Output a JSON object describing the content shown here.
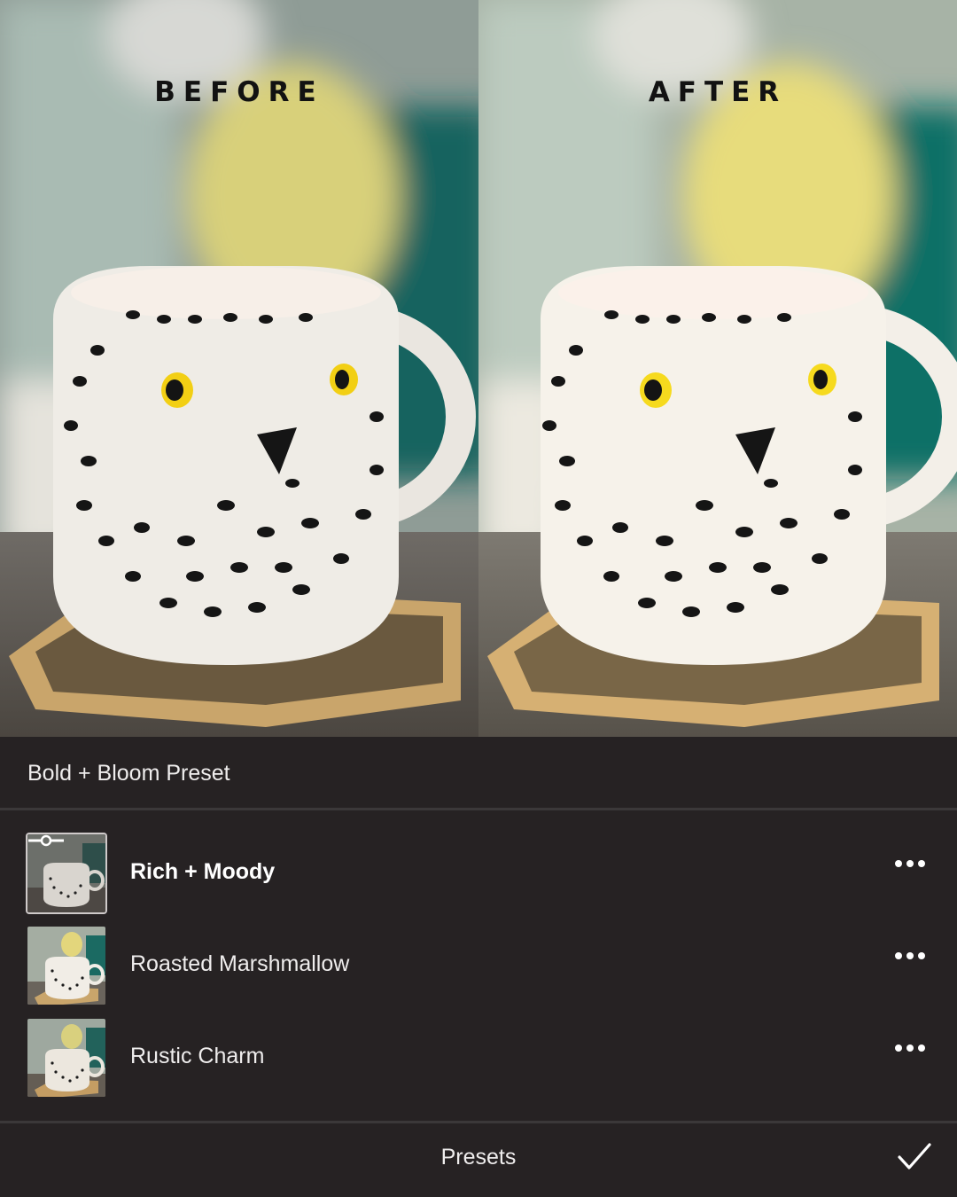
{
  "compare": {
    "before_label": "BEFORE",
    "after_label": "AFTER"
  },
  "panel": {
    "group_title": "Bold + Bloom Preset",
    "presets": [
      {
        "name": "Rich + Moody",
        "selected": true,
        "menu_icon": "more-horizontal-icon"
      },
      {
        "name": "Roasted Marshmallow",
        "selected": false,
        "menu_icon": "more-horizontal-icon"
      },
      {
        "name": "Rustic Charm",
        "selected": false,
        "menu_icon": "more-horizontal-icon"
      }
    ]
  },
  "footer": {
    "title": "Presets",
    "confirm_icon": "checkmark-icon"
  },
  "colors": {
    "panel_bg": "#262223",
    "text": "#efeded",
    "divider": "#3b3839"
  }
}
